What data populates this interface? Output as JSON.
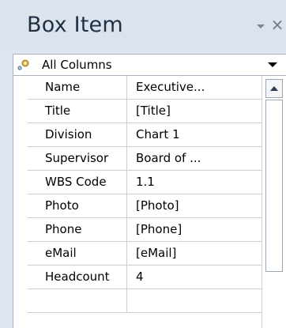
{
  "pane": {
    "title": "Box Item",
    "menu_icon": "chevron-down-icon",
    "close_label": "×"
  },
  "filter": {
    "icon": "gear-filter-icon",
    "selected": "All Columns"
  },
  "properties": [
    {
      "name": "Name",
      "value": "Executive..."
    },
    {
      "name": "Title",
      "value": "[Title]"
    },
    {
      "name": "Division",
      "value": "Chart 1"
    },
    {
      "name": "Supervisor",
      "value": "Board of ..."
    },
    {
      "name": "WBS Code",
      "value": "1.1"
    },
    {
      "name": "Photo",
      "value": "[Photo]"
    },
    {
      "name": "Phone",
      "value": "[Phone]"
    },
    {
      "name": "eMail",
      "value": "[eMail]"
    },
    {
      "name": "Headcount",
      "value": "4"
    },
    {
      "name": "",
      "value": ""
    }
  ],
  "colors": {
    "pane_background": "#dfe6ef",
    "title_text": "#1f2f44",
    "grid_lines": "#c9cfd6"
  }
}
